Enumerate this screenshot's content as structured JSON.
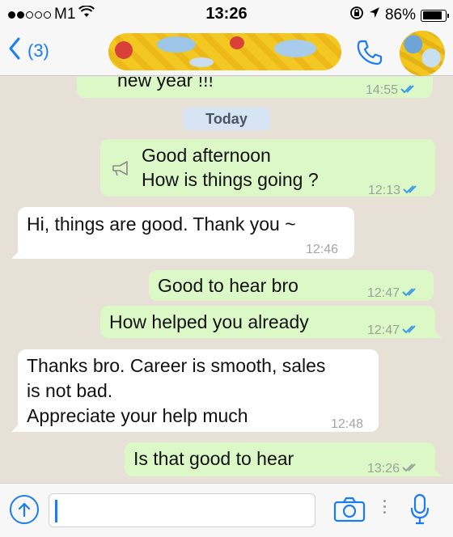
{
  "status_bar": {
    "carrier": "M1",
    "time": "13:26",
    "battery": "86%",
    "battery_level": 0.86
  },
  "header": {
    "back_label": "(3)"
  },
  "colors": {
    "accent": "#1a7cf5",
    "outgoing_bubble": "#dcf8c6",
    "incoming_bubble": "#ffffff",
    "read_tick": "#3b9be8",
    "delivered_tick": "#9aa39a"
  },
  "date_separator": "Today",
  "messages": [
    {
      "direction": "out",
      "lines": [
        "new year !!!"
      ],
      "time": "14:55",
      "status": "read"
    },
    {
      "direction": "out",
      "forwarded_icon": "megaphone-icon",
      "lines": [
        "Good afternoon",
        "How is things going ?"
      ],
      "time": "12:13",
      "status": "read"
    },
    {
      "direction": "in",
      "lines": [
        "Hi, things are good. Thank you  ~"
      ],
      "time": "12:46"
    },
    {
      "direction": "out",
      "lines": [
        "Good to hear bro"
      ],
      "time": "12:47",
      "status": "read"
    },
    {
      "direction": "out",
      "lines": [
        "How helped you already"
      ],
      "time": "12:47",
      "status": "read"
    },
    {
      "direction": "in",
      "lines": [
        "Thanks bro. Career is smooth, sales",
        "is not bad.",
        "Appreciate your help much"
      ],
      "time": "12:48"
    },
    {
      "direction": "out",
      "lines": [
        "Is that good to hear"
      ],
      "time": "13:26",
      "status": "delivered"
    }
  ],
  "input_bar": {
    "icons": [
      "upload-icon",
      "camera-icon",
      "microphone-icon"
    ],
    "placeholder": ""
  }
}
